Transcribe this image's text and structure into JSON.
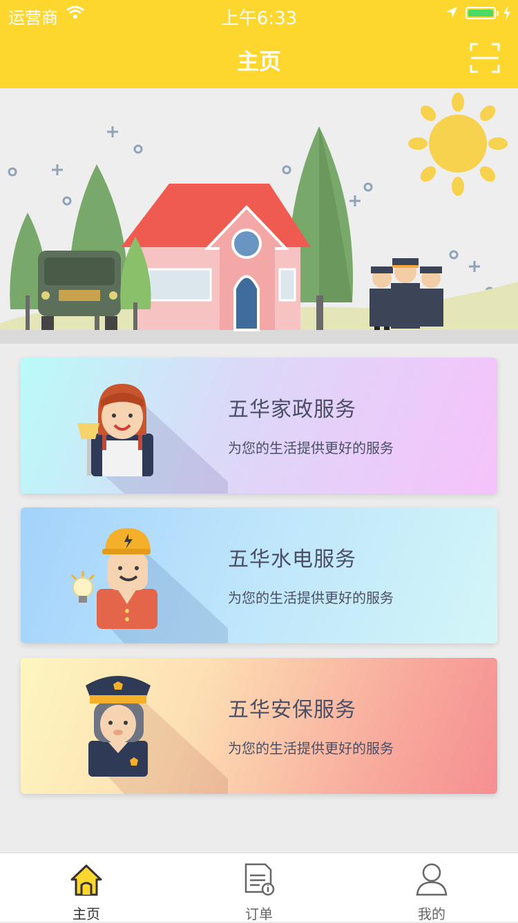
{
  "status_bar": {
    "carrier": "运营商",
    "time": "上午6:33"
  },
  "nav": {
    "title": "主页",
    "scan_icon": "scan-icon"
  },
  "colors": {
    "accent": "#fdd62e",
    "tab_active_icon": "#fdd62e"
  },
  "services": [
    {
      "title": "五华家政服务",
      "subtitle": "为您的生活提供更好的服务",
      "icon": "housekeeper-icon"
    },
    {
      "title": "五华水电服务",
      "subtitle": "为您的生活提供更好的服务",
      "icon": "electrician-icon"
    },
    {
      "title": "五华安保服务",
      "subtitle": "为您的生活提供更好的服务",
      "icon": "security-guard-icon"
    }
  ],
  "tabs": [
    {
      "label": "主页",
      "icon": "home-icon",
      "active": true
    },
    {
      "label": "订单",
      "icon": "order-icon",
      "active": false
    },
    {
      "label": "我的",
      "icon": "profile-icon",
      "active": false
    }
  ]
}
